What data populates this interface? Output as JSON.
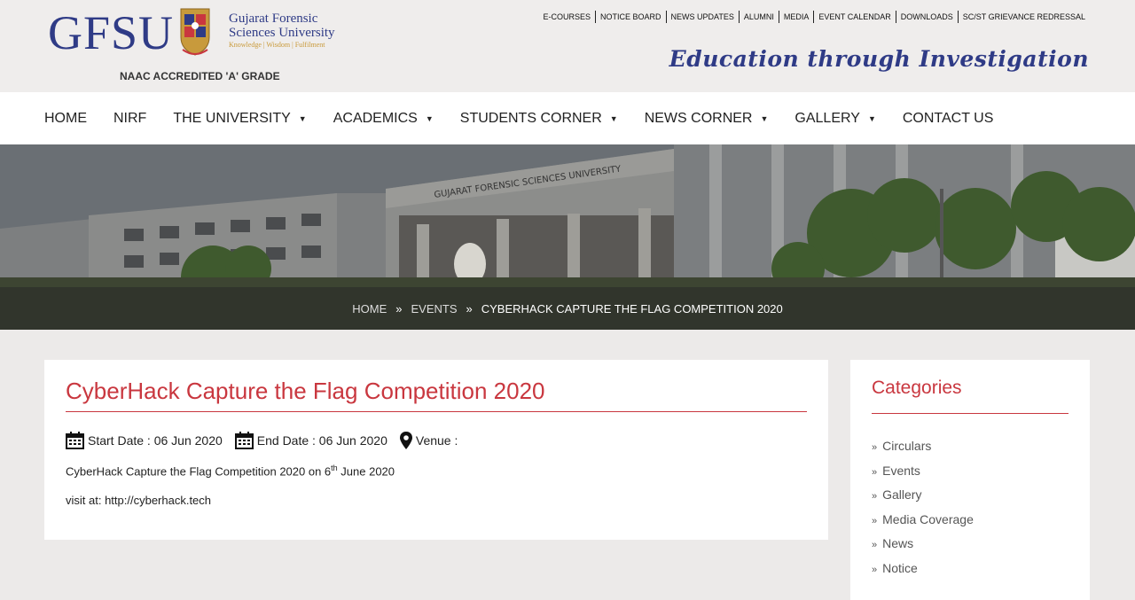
{
  "header": {
    "logo_abbr": "GFSU",
    "university_name": "Gujarat Forensic Sciences University",
    "tagline": "Knowledge | Wisdom | Fulfilment",
    "accreditation": "NAAC ACCREDITED 'A' GRADE",
    "motto": "Education through Investigation",
    "top_links": [
      "E-COURSES",
      "NOTICE BOARD",
      "NEWS UPDATES",
      "ALUMNI",
      "MEDIA",
      "EVENT CALENDAR",
      "DOWNLOADS",
      "SC/ST GRIEVANCE REDRESSAL"
    ]
  },
  "nav": {
    "items": [
      {
        "label": "HOME",
        "dropdown": false
      },
      {
        "label": "NIRF",
        "dropdown": false
      },
      {
        "label": "THE UNIVERSITY",
        "dropdown": true
      },
      {
        "label": "ACADEMICS",
        "dropdown": true
      },
      {
        "label": "STUDENTS CORNER",
        "dropdown": true
      },
      {
        "label": "NEWS CORNER",
        "dropdown": true
      },
      {
        "label": "GALLERY",
        "dropdown": true
      },
      {
        "label": "CONTACT US",
        "dropdown": false
      }
    ]
  },
  "banner": {
    "building_sign": "GUJARAT FORENSIC SCIENCES UNIVERSITY",
    "breadcrumb": [
      "HOME",
      "EVENTS",
      "CYBERHACK CAPTURE THE FLAG COMPETITION 2020"
    ],
    "separator": "»"
  },
  "event": {
    "title": "CyberHack Capture the Flag Competition 2020",
    "start_date": "Start Date : 06 Jun 2020",
    "end_date": "End Date : 06 Jun 2020",
    "venue": "Venue :",
    "desc_prefix": "CyberHack Capture the Flag Competition 2020 on 6",
    "desc_sup": "th",
    "desc_suffix": " June 2020",
    "visit": "visit at: http://cyberhack.tech"
  },
  "sidebar": {
    "title": "Categories",
    "items": [
      "Circulars",
      "Events",
      "Gallery",
      "Media Coverage",
      "News",
      "Notice"
    ]
  },
  "colors": {
    "brand_blue": "#2f3b86",
    "accent_red": "#c9373f",
    "gold": "#c99a3a"
  }
}
